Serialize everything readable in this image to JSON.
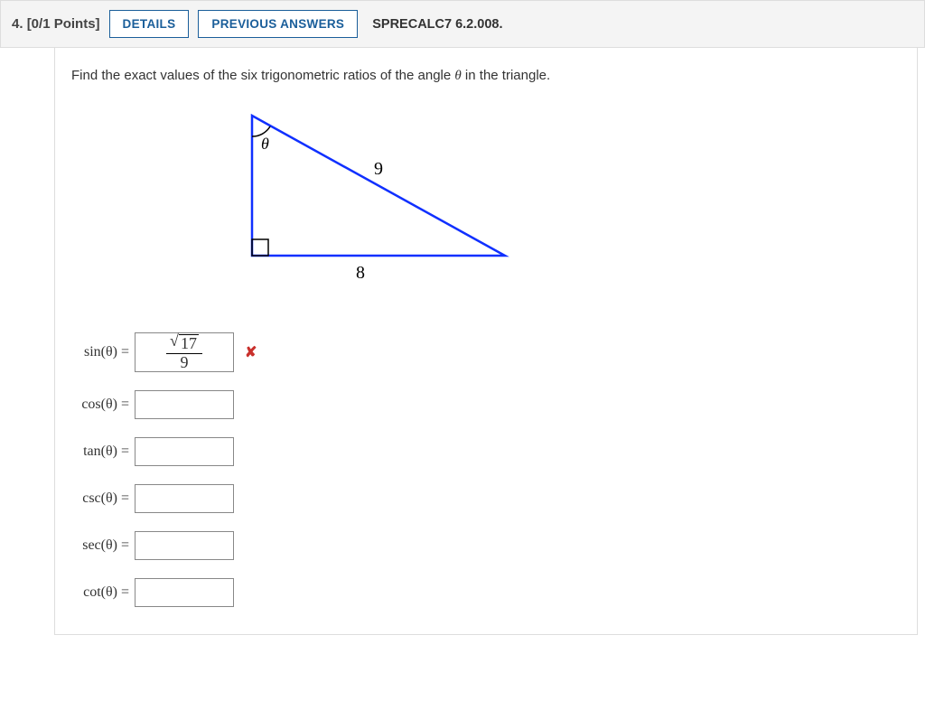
{
  "header": {
    "number": "4.",
    "points": "[0/1 Points]",
    "details_btn": "DETAILS",
    "prev_answers_btn": "PREVIOUS ANSWERS",
    "code": "SPRECALC7 6.2.008."
  },
  "prompt": {
    "before": "Find the exact values of the six trigonometric ratios of the angle ",
    "theta": "θ",
    "after": " in the triangle."
  },
  "figure": {
    "theta_label": "θ",
    "hypotenuse": "9",
    "base": "8"
  },
  "answers": {
    "sin": {
      "label": "sin(θ) =",
      "value_num_sqrt": "17",
      "value_den": "9",
      "incorrect": true
    },
    "cos": {
      "label": "cos(θ) ="
    },
    "tan": {
      "label": "tan(θ) ="
    },
    "csc": {
      "label": "csc(θ) ="
    },
    "sec": {
      "label": "sec(θ) ="
    },
    "cot": {
      "label": "cot(θ) ="
    }
  },
  "icons": {
    "incorrect": "✘"
  }
}
